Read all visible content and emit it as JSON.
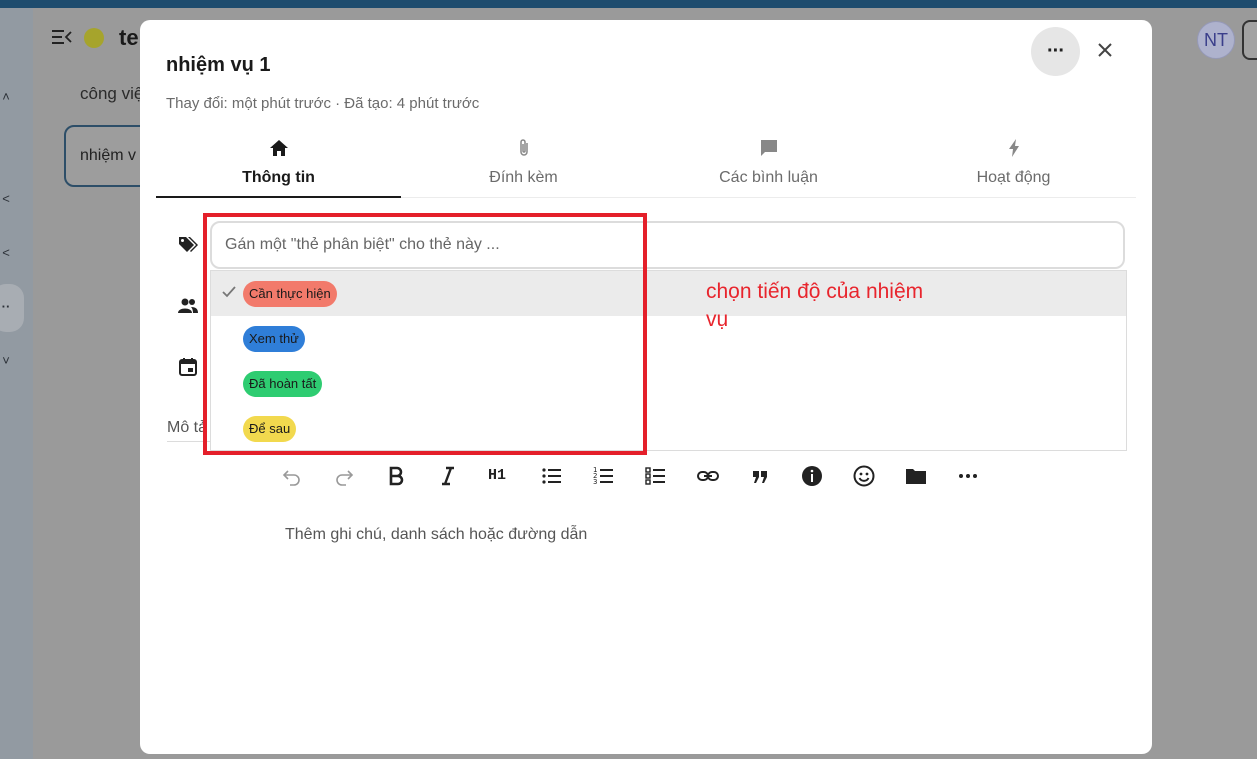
{
  "background": {
    "board_title": "te",
    "column_title": "công việ",
    "card_title": "nhiệm v",
    "avatar_initials": "NT",
    "board_color": "#a6a42c"
  },
  "modal": {
    "title": "nhiệm vụ 1",
    "meta": "Thay đổi: một phút trước · Đã tạo: 4 phút trước",
    "more_icon": "more-horizontal-icon",
    "close_icon": "close-icon"
  },
  "tabs": [
    {
      "label": "Thông tin",
      "icon": "home-icon",
      "active": true
    },
    {
      "label": "Đính kèm",
      "icon": "paperclip-icon",
      "active": false
    },
    {
      "label": "Các bình luận",
      "icon": "comment-icon",
      "active": false
    },
    {
      "label": "Hoạt động",
      "icon": "lightning-icon",
      "active": false
    }
  ],
  "tags": {
    "placeholder": "Gán một \"thẻ phân biệt\" cho thẻ này ...",
    "options": [
      {
        "label": "Cần thực hiện",
        "color": "#f27a6b",
        "selected": true
      },
      {
        "label": "Xem thử",
        "color": "#2f7ed8",
        "selected": false
      },
      {
        "label": "Đã hoàn tất",
        "color": "#2ecc71",
        "selected": false
      },
      {
        "label": "Để sau",
        "color": "#f2d94e",
        "selected": false
      }
    ]
  },
  "description": {
    "label": "Mô tả",
    "placeholder": "Thêm ghi chú, danh sách hoặc đường dẫn"
  },
  "toolbar": {
    "h1_label": "H1",
    "items": [
      "undo-icon",
      "redo-icon",
      "bold-icon",
      "italic-icon",
      "heading-icon",
      "bullet-list-icon",
      "numbered-list-icon",
      "checklist-icon",
      "link-icon",
      "quote-icon",
      "info-icon",
      "emoji-icon",
      "folder-icon",
      "more-horizontal-icon"
    ]
  },
  "annotation": {
    "text": "chọn tiến độ của nhiệm vụ",
    "color": "#e8252d"
  }
}
